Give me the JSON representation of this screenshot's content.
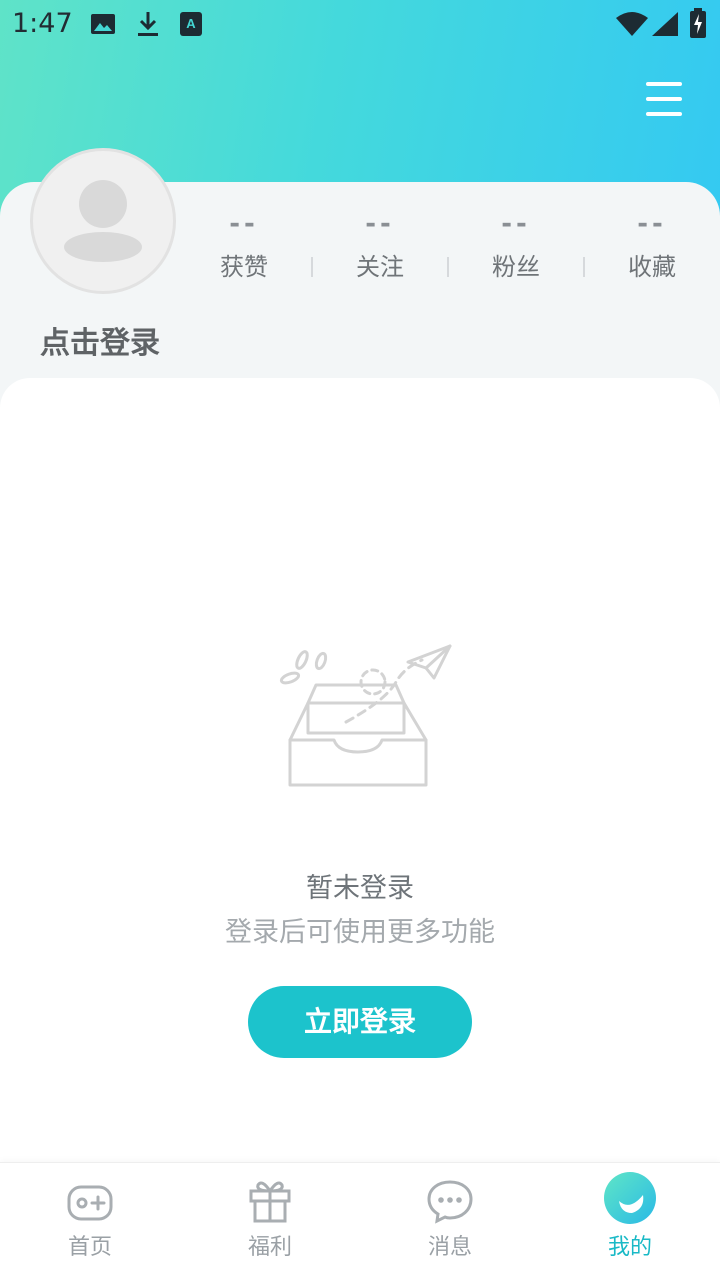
{
  "status_bar": {
    "time": "1:47",
    "icons": [
      "image-icon",
      "download-icon",
      "keyboard-a-icon",
      "wifi-icon",
      "signal-icon",
      "battery-charging-icon"
    ]
  },
  "header": {
    "menu_icon": "hamburger-menu-icon",
    "gradient_colors": [
      "#5fe3c8",
      "#34c9f2"
    ]
  },
  "profile": {
    "avatar_icon": "default-avatar-icon",
    "login_prompt": "点击登录",
    "stats": [
      {
        "value": "--",
        "label": "获赞"
      },
      {
        "value": "--",
        "label": "关注"
      },
      {
        "value": "--",
        "label": "粉丝"
      },
      {
        "value": "--",
        "label": "收藏"
      }
    ]
  },
  "empty_state": {
    "illustration_icon": "empty-inbox-paper-plane-icon",
    "title": "暂未登录",
    "description": "登录后可使用更多功能",
    "button_label": "立即登录"
  },
  "tabs": [
    {
      "label": "首页",
      "icon": "gamepad-icon",
      "active": false
    },
    {
      "label": "福利",
      "icon": "gift-icon",
      "active": false
    },
    {
      "label": "消息",
      "icon": "chat-bubble-icon",
      "active": false
    },
    {
      "label": "我的",
      "icon": "mine-smile-icon",
      "active": true
    }
  ],
  "colors": {
    "accent": "#1cc3cc",
    "active_tab": "#19b9c6"
  }
}
